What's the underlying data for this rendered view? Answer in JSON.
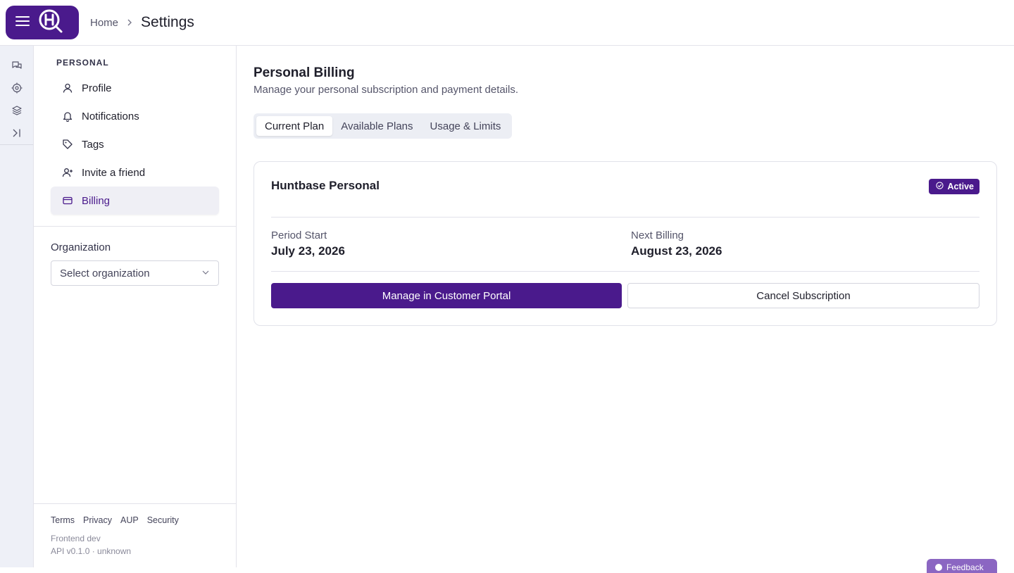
{
  "header": {
    "breadcrumb_home": "Home",
    "page_title": "Settings"
  },
  "sidebar": {
    "section_label": "PERSONAL",
    "items": [
      {
        "label": "Profile",
        "icon": "user-icon"
      },
      {
        "label": "Notifications",
        "icon": "bell-icon"
      },
      {
        "label": "Tags",
        "icon": "tag-icon"
      },
      {
        "label": "Invite a friend",
        "icon": "user-plus-icon"
      },
      {
        "label": "Billing",
        "icon": "wallet-icon",
        "active": true
      }
    ],
    "org_label": "Organization",
    "org_select_placeholder": "Select organization",
    "footer_links": [
      "Terms",
      "Privacy",
      "AUP",
      "Security"
    ],
    "footer_env": "Frontend dev",
    "footer_api": "API v0.1.0 · unknown"
  },
  "main": {
    "title": "Personal Billing",
    "subtitle": "Manage your personal subscription and payment details.",
    "tabs": [
      {
        "label": "Current Plan",
        "active": true
      },
      {
        "label": "Available Plans"
      },
      {
        "label": "Usage & Limits"
      }
    ],
    "plan": {
      "name": "Huntbase Personal",
      "status": "Active",
      "period_start_label": "Period Start",
      "period_start_value": "July 23, 2026",
      "next_billing_label": "Next Billing",
      "next_billing_value": "August 23, 2026",
      "manage_button": "Manage in Customer Portal",
      "cancel_button": "Cancel Subscription"
    },
    "feedback_label": "Feedback"
  },
  "colors": {
    "brand": "#4a1a8c",
    "rail_bg": "#eef0f7",
    "active_bg": "#efeff5"
  }
}
